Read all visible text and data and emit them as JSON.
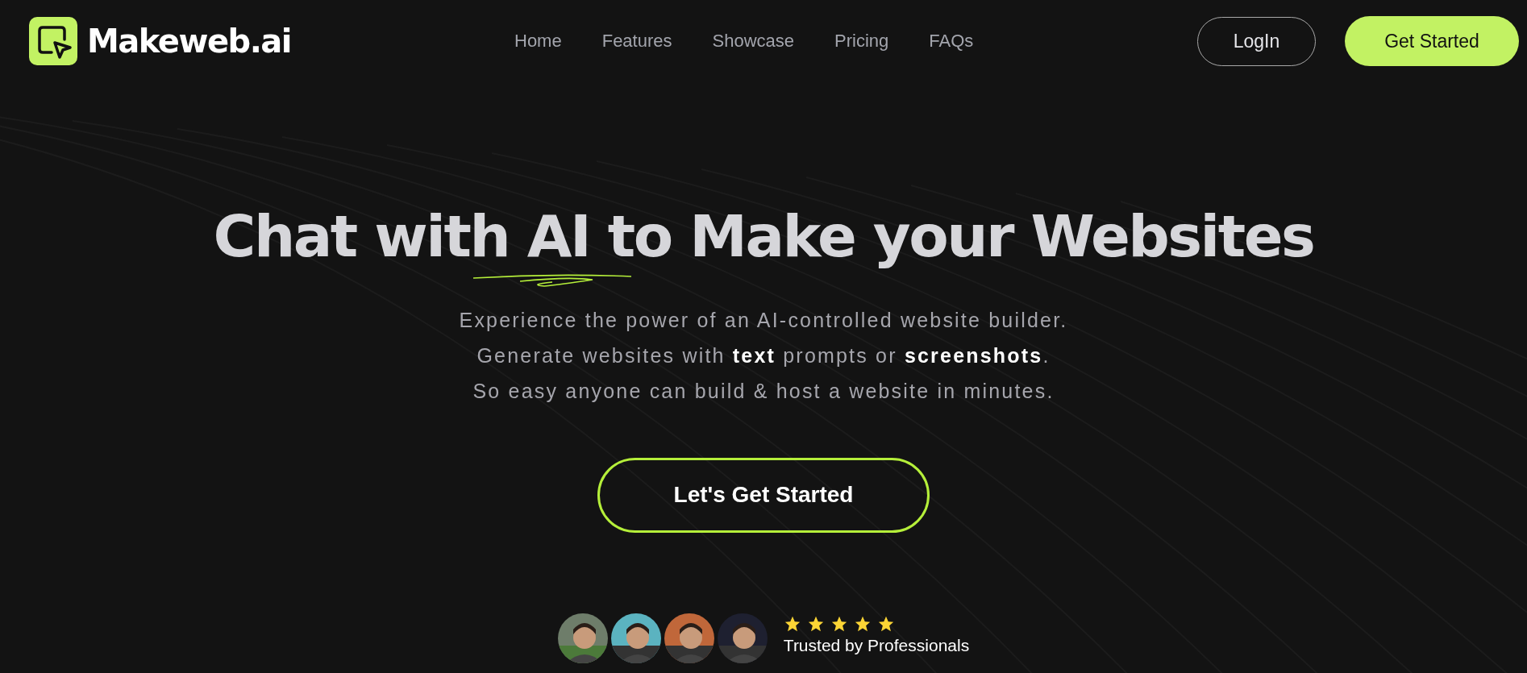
{
  "brand": {
    "name": "Makeweb.ai"
  },
  "nav": [
    {
      "label": "Home"
    },
    {
      "label": "Features"
    },
    {
      "label": "Showcase"
    },
    {
      "label": "Pricing"
    },
    {
      "label": "FAQs"
    }
  ],
  "actions": {
    "login": "LogIn",
    "get_started": "Get Started"
  },
  "hero": {
    "title": "Chat with AI to Make your Websites",
    "lines": [
      "Experience the power of an AI-controlled website builder.",
      "Generate websites with **text** prompts or **screenshots**.",
      "So easy anyone can build & host a website in minutes."
    ],
    "cta": "Let's Get Started"
  },
  "social_proof": {
    "avatars": [
      {
        "kind": "picture"
      },
      {
        "kind": "picture"
      },
      {
        "kind": "picture"
      },
      {
        "kind": "picture"
      }
    ],
    "stars": 5,
    "caption": "Trusted by Professionals"
  }
}
